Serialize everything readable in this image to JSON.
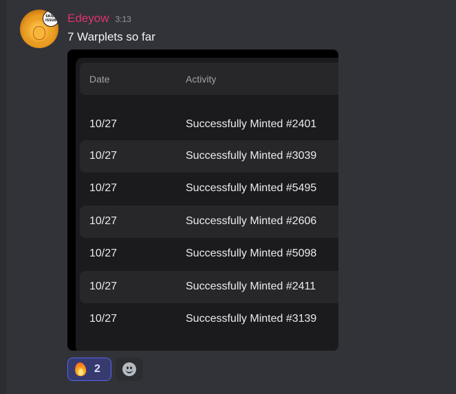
{
  "message": {
    "username": "Edeyow",
    "username_color": "#e0336e",
    "timestamp": "3:13",
    "text": "7 Warplets so far",
    "avatar": {
      "icon": "lion-avatar-icon",
      "badge_text": "SKILL ISSUE"
    }
  },
  "attachment": {
    "table": {
      "columns": [
        "Date",
        "Activity"
      ],
      "rows": [
        {
          "date": "10/27",
          "activity": "Successfully Minted #2401"
        },
        {
          "date": "10/27",
          "activity": "Successfully Minted #3039"
        },
        {
          "date": "10/27",
          "activity": "Successfully Minted #5495"
        },
        {
          "date": "10/27",
          "activity": "Successfully Minted #2606"
        },
        {
          "date": "10/27",
          "activity": "Successfully Minted #5098"
        },
        {
          "date": "10/27",
          "activity": "Successfully Minted #2411"
        },
        {
          "date": "10/27",
          "activity": "Successfully Minted #3139"
        }
      ]
    }
  },
  "reactions": [
    {
      "icon": "fire-icon",
      "count": "2",
      "active": true
    }
  ],
  "add_reaction": {
    "icon": "add-reaction-icon"
  }
}
